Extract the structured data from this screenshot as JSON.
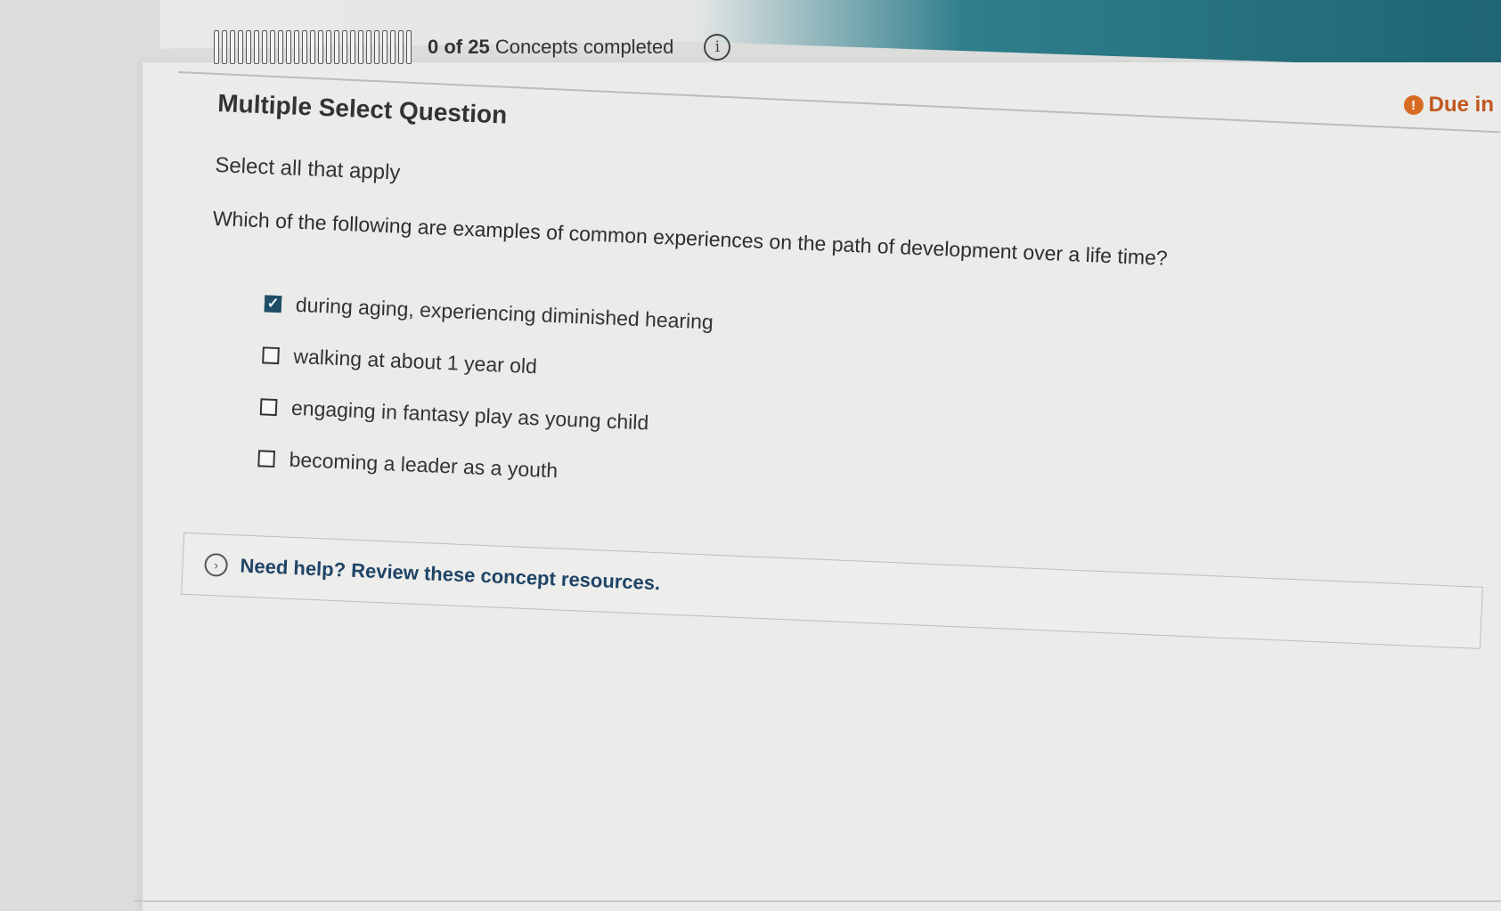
{
  "progress": {
    "segments": 25,
    "completed_count": "0 of 25",
    "completed_suffix": "Concepts completed"
  },
  "due": {
    "label": "Due in"
  },
  "question": {
    "type": "Multiple Select Question",
    "instruction": "Select all that apply",
    "prompt": "Which of the following are examples of common experiences on the path of development over a life time?",
    "options": [
      {
        "label": "during aging, experiencing diminished hearing",
        "checked": true
      },
      {
        "label": "walking at about 1 year old",
        "checked": false
      },
      {
        "label": "engaging in fantasy play as young child",
        "checked": false
      },
      {
        "label": "becoming a leader as a youth",
        "checked": false
      }
    ]
  },
  "help": {
    "label": "Need help? Review these concept resources."
  },
  "icons": {
    "info": "info-icon",
    "due": "alert-icon",
    "help": "chevron-right-icon",
    "check": "check-icon"
  },
  "colors": {
    "accent": "#1f4f66",
    "due": "#c0581e",
    "header_teal": "#2f7e8c"
  }
}
